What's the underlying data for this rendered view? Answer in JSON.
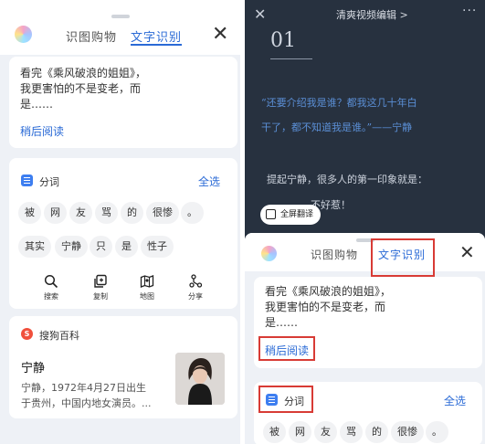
{
  "left_panel": {
    "tabs": [
      "识图购物",
      "文字识别"
    ],
    "close_label": "✕",
    "ocr_lines": [
      "看完《乘风破浪的姐姐》，",
      "我更害怕的不是变老，而",
      "是……"
    ],
    "read_later": "稍后阅读",
    "segment": {
      "title": "分词",
      "select_all": "全选",
      "chips_row1": [
        "被",
        "网",
        "友",
        "骂",
        "的",
        "很惨",
        "。"
      ],
      "chips_row2": [
        "其实",
        "宁静",
        "只",
        "是",
        "性子"
      ]
    },
    "actions": [
      {
        "label": "搜索",
        "icon": "search-icon"
      },
      {
        "label": "复制",
        "icon": "copy-icon"
      },
      {
        "label": "地图",
        "icon": "map-icon"
      },
      {
        "label": "分享",
        "icon": "share-icon"
      }
    ],
    "baike": {
      "title": "搜狗百科",
      "badge": "S",
      "name": "宁静",
      "desc_lines": [
        "宁静，1972年4月27日出生",
        "于贵州，中国内地女演员。..."
      ]
    }
  },
  "right_panel": {
    "header": {
      "close": "✕",
      "title": "清爽视频编辑 >",
      "more": "···"
    },
    "video_text": {
      "number": "01",
      "quote_lines": [
        "“还要介绍我是谁？都我这几十年白",
        "干了，都不知道我是谁。”——宁静"
      ],
      "body_lines": [
        "提起宁静，很多人的第一印象就是：",
        "不好惹！"
      ]
    },
    "translate_button": "全屏翻译",
    "sheet": {
      "tabs": [
        "识图购物",
        "文字识别"
      ],
      "close_label": "✕",
      "ocr_lines": [
        "看完《乘风破浪的姐姐》，",
        "我更害怕的不是变老，而",
        "是……"
      ],
      "read_later": "稍后阅读",
      "segment_title": "分词",
      "select_all": "全选",
      "chips": [
        "被",
        "网",
        "友",
        "骂",
        "的",
        "很惨",
        "。"
      ]
    }
  },
  "colors": {
    "accent": "#2a6ad6",
    "highlight": "#d83b35",
    "video_bg": "#27313f",
    "sheet_bg": "#eef1f6"
  }
}
